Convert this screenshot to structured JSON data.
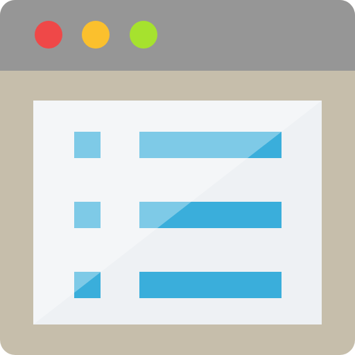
{
  "window": {
    "titlebar_color": "#969696",
    "frame_color": "#c6beab",
    "buttons": [
      {
        "icon": "close-dot",
        "color": "#ef4848"
      },
      {
        "icon": "minimize-dot",
        "color": "#fbc02d"
      },
      {
        "icon": "maximize-dot",
        "color": "#a6e22e"
      }
    ]
  },
  "document": {
    "background_color": "#eef1f4",
    "accent_color": "#3aaedb",
    "list_items": 3
  }
}
